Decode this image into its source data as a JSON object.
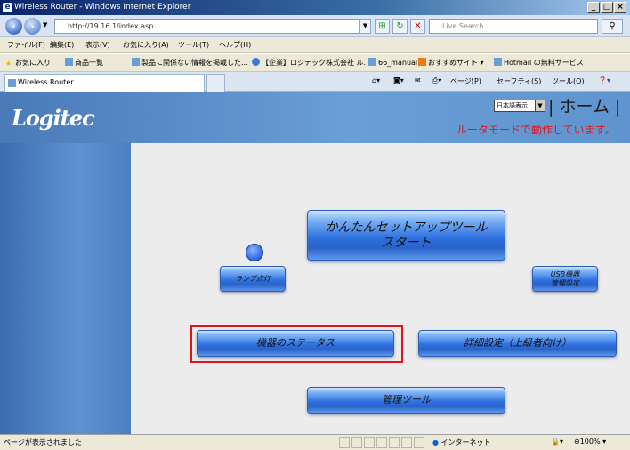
{
  "window": {
    "title": "Wireless Router - Windows Internet Explorer",
    "controls": [
      "_",
      "□",
      "×"
    ]
  },
  "address_bar": {
    "url": "http://19.16.1/index.asp",
    "search_placeholder": "Live Search"
  },
  "menu": [
    "ファイル(F)",
    "編集(E)",
    "表示(V)",
    "お気に入り(A)",
    "ツール(T)",
    "ヘルプ(H)"
  ],
  "favorites_bar": {
    "label": "お気に入り",
    "items": [
      "商品一覧",
      "製品に関係ない情報を掲載した...",
      "【企業】ロジテック株式会社 ル...",
      "66_manual",
      "おすすめサイト",
      "Hotmail の無料サービス"
    ]
  },
  "tab": {
    "title": "Wireless Router",
    "tools": [
      "ページ(P)",
      "セーフティ(S)",
      "ツール(O)"
    ]
  },
  "router_ui": {
    "logo": "Logitec",
    "language_select": "日本語表示",
    "home_link": "| ホーム |",
    "status_message": "ルータモードで動作しています。",
    "buttons": {
      "setup_tool": "かんたんセットアップツール\nスタート",
      "lamp_status": "ランプ点灯",
      "usb_settings": "USB機器\n管理設定",
      "device_status": "機器のステータス",
      "advanced_settings": "詳細設定（上級者向け）",
      "admin_tool": "管理ツール"
    }
  },
  "status_bar": {
    "text": "ページが表示されました",
    "zone": "インターネット",
    "zoom": "100%"
  },
  "colors": {
    "status_message": "#e8141c",
    "selection_border": "#e0141c",
    "banner_blue": "#5a8ec8"
  }
}
